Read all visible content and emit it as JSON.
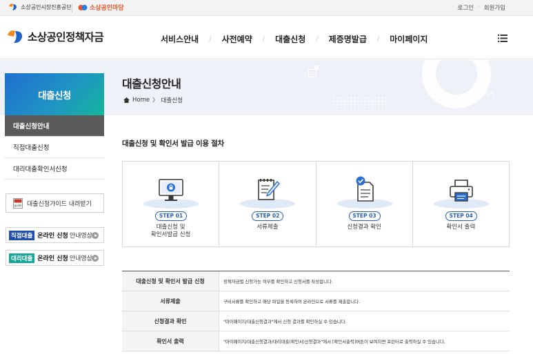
{
  "util": {
    "org_name": "소상공인시장진흥공단",
    "yard_name": "소상공인마당",
    "login": "로그인",
    "join": "회원가입",
    "dot": "·"
  },
  "header": {
    "site_name": "소상공인정책자금",
    "nav": [
      "서비스안내",
      "사전예약",
      "대출신청",
      "제증명발급",
      "마이페이지"
    ],
    "nav_sep": "/"
  },
  "banner": {
    "title": "대출신청안내",
    "home": "Home",
    "crumb_sep": "〉",
    "current": "대출신청"
  },
  "sidebar": {
    "heading": "대출신청",
    "items": [
      {
        "label": "대출신청안내",
        "active": true
      },
      {
        "label": "직접대출신청",
        "active": false
      },
      {
        "label": "대리대출확인서신청",
        "active": false
      }
    ],
    "guide_button": "대출신청가이드 내려받기",
    "guide_icon_text": "guide",
    "videos": [
      {
        "tag": "직접대출",
        "tag_color": "#1f4fb0",
        "bold": "온라인 신청",
        "rest": "안내영상"
      },
      {
        "tag": "대리대출",
        "tag_color": "#14a79a",
        "bold": "온라인 신청",
        "rest": "안내영상"
      }
    ]
  },
  "main": {
    "section_title": "대출신청 및 확인서 발급 이용 절차",
    "steps": [
      {
        "badge": "STEP 01",
        "label": "대출신청 및\n확인서발급 신청",
        "icon": "computer-lock-icon"
      },
      {
        "badge": "STEP 02",
        "label": "서류제출",
        "icon": "document-edit-icon"
      },
      {
        "badge": "STEP 03",
        "label": "신청결과 확인",
        "icon": "document-check-icon"
      },
      {
        "badge": "STEP 04",
        "label": "확인서 출력",
        "icon": "printer-icon"
      }
    ],
    "table": [
      {
        "head": "대출신청 및 확인서 발급 신청",
        "desc": "정책자금별 신청가능 여부를 확인하고 신청서를 작성합니다."
      },
      {
        "head": "서류제출",
        "desc": "구비서류를 확인하고 해당 파일을 등록하여 온라인으로 서류를 제출합니다."
      },
      {
        "head": "신청결과 확인",
        "desc": "\"마이페이지/대출신청결과\"에서 신청 결과를 확인하실 수 있습니다."
      },
      {
        "head": "확인서 출력",
        "desc": "\"마이페이지/대출신청결과/대리대출(확인서)신청결과\"에서 [확인서출력]버튼이 보여지면 프린터로 출력하실 수 있습니다."
      }
    ]
  },
  "colors": {
    "accent_blue": "#2a5fb3",
    "side_active": "#5b5b5b",
    "logo_orange": "#f08a1c",
    "logo_blue": "#1f63c6"
  }
}
